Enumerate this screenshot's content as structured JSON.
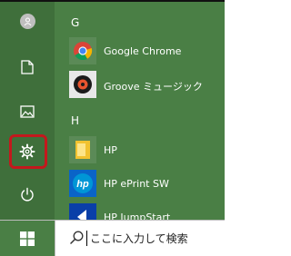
{
  "start_menu": {
    "sections": [
      {
        "letter": "G",
        "apps": [
          {
            "label": "Google Chrome",
            "icon": "chrome-icon"
          },
          {
            "label": "Groove ミュージック",
            "icon": "groove-music-icon"
          }
        ]
      },
      {
        "letter": "H",
        "apps": [
          {
            "label": "HP",
            "icon": "folder-icon"
          },
          {
            "label": "HP ePrint SW",
            "icon": "hp-icon"
          },
          {
            "label": "HP JumpStart",
            "icon": "hp-jumpstart-icon"
          }
        ]
      }
    ],
    "rail": [
      {
        "name": "user-account",
        "icon": "user-icon"
      },
      {
        "name": "documents",
        "icon": "document-icon"
      },
      {
        "name": "pictures",
        "icon": "picture-icon"
      },
      {
        "name": "settings",
        "icon": "gear-icon",
        "highlighted": true
      },
      {
        "name": "power",
        "icon": "power-icon"
      }
    ]
  },
  "taskbar": {
    "search_text": "ここに入力して検索"
  },
  "colors": {
    "accent": "#4a7f45",
    "rail": "#3f6f3b",
    "highlight": "#c3181d"
  }
}
